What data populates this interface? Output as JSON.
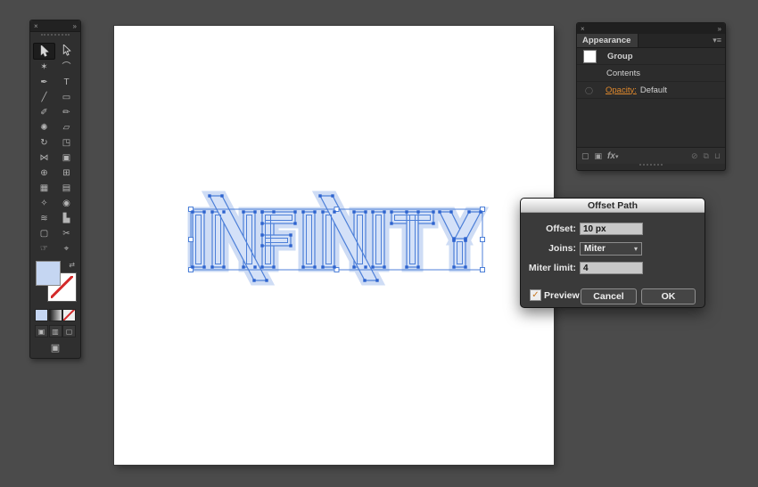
{
  "canvas": {
    "text": "INFINITY",
    "selection_color": "#4c7fd8",
    "silhouette_color": "#c3d4f3",
    "letter_fill": "#d4e1f8",
    "anchor_color": "#2d63cf"
  },
  "icons": {
    "close": "×",
    "collapse": "»",
    "menu": "≡",
    "menu_arrow": "▾",
    "select_arrow": "▾",
    "check": "✓",
    "swap": "⇄",
    "screen_mode": "▣"
  },
  "toolbar": {
    "tools": [
      {
        "name": "selection-tool",
        "glyph": "cursor-filled",
        "active": true
      },
      {
        "name": "direct-selection-tool",
        "glyph": "cursor-outline"
      },
      {
        "name": "magic-wand-tool",
        "glyph": "✶"
      },
      {
        "name": "lasso-tool",
        "glyph": "⌒"
      },
      {
        "name": "pen-tool",
        "glyph": "✒"
      },
      {
        "name": "type-tool",
        "glyph": "T"
      },
      {
        "name": "line-segment-tool",
        "glyph": "╱"
      },
      {
        "name": "rectangle-tool",
        "glyph": "▭"
      },
      {
        "name": "paintbrush-tool",
        "glyph": "✐"
      },
      {
        "name": "pencil-tool",
        "glyph": "✏"
      },
      {
        "name": "blob-brush-tool",
        "glyph": "✺"
      },
      {
        "name": "eraser-tool",
        "glyph": "▱"
      },
      {
        "name": "rotate-tool",
        "glyph": "↻"
      },
      {
        "name": "scale-tool",
        "glyph": "◳"
      },
      {
        "name": "width-tool",
        "glyph": "⋈"
      },
      {
        "name": "free-transform-tool",
        "glyph": "▣"
      },
      {
        "name": "shape-builder-tool",
        "glyph": "⊕"
      },
      {
        "name": "perspective-grid-tool",
        "glyph": "⊞"
      },
      {
        "name": "mesh-tool",
        "glyph": "▦"
      },
      {
        "name": "gradient-tool",
        "glyph": "▤"
      },
      {
        "name": "eyedropper-tool",
        "glyph": "✧"
      },
      {
        "name": "blend-tool",
        "glyph": "◉"
      },
      {
        "name": "symbol-sprayer-tool",
        "glyph": "≋"
      },
      {
        "name": "column-graph-tool",
        "glyph": "▙"
      },
      {
        "name": "artboard-tool",
        "glyph": "▢"
      },
      {
        "name": "slice-tool",
        "glyph": "✂"
      },
      {
        "name": "hand-tool",
        "glyph": "☞"
      },
      {
        "name": "zoom-tool",
        "glyph": "⌖"
      }
    ],
    "fill_color": "#c5d6f2"
  },
  "appearance_panel": {
    "tab": "Appearance",
    "rows": [
      {
        "label": "Group",
        "thumb": true
      },
      {
        "label": "Contents",
        "indent": true
      },
      {
        "prefix": "Opacity:",
        "label": "Default",
        "eye": true
      }
    ],
    "footer": {
      "add_stroke": "▢",
      "add_fill": "▣",
      "fx": "fx",
      "clear": "⊘",
      "duplicate": "⧉",
      "delete": "⊔"
    },
    "accent_orange": "#e0892c"
  },
  "dialog": {
    "title": "Offset Path",
    "fields": [
      {
        "label": "Offset:",
        "value": "10 px",
        "type": "input"
      },
      {
        "label": "Joins:",
        "value": "Miter",
        "type": "select"
      },
      {
        "label": "Miter limit:",
        "value": "4",
        "type": "input"
      }
    ],
    "preview_label": "Preview",
    "preview_checked": true,
    "cancel_label": "Cancel",
    "ok_label": "OK"
  }
}
